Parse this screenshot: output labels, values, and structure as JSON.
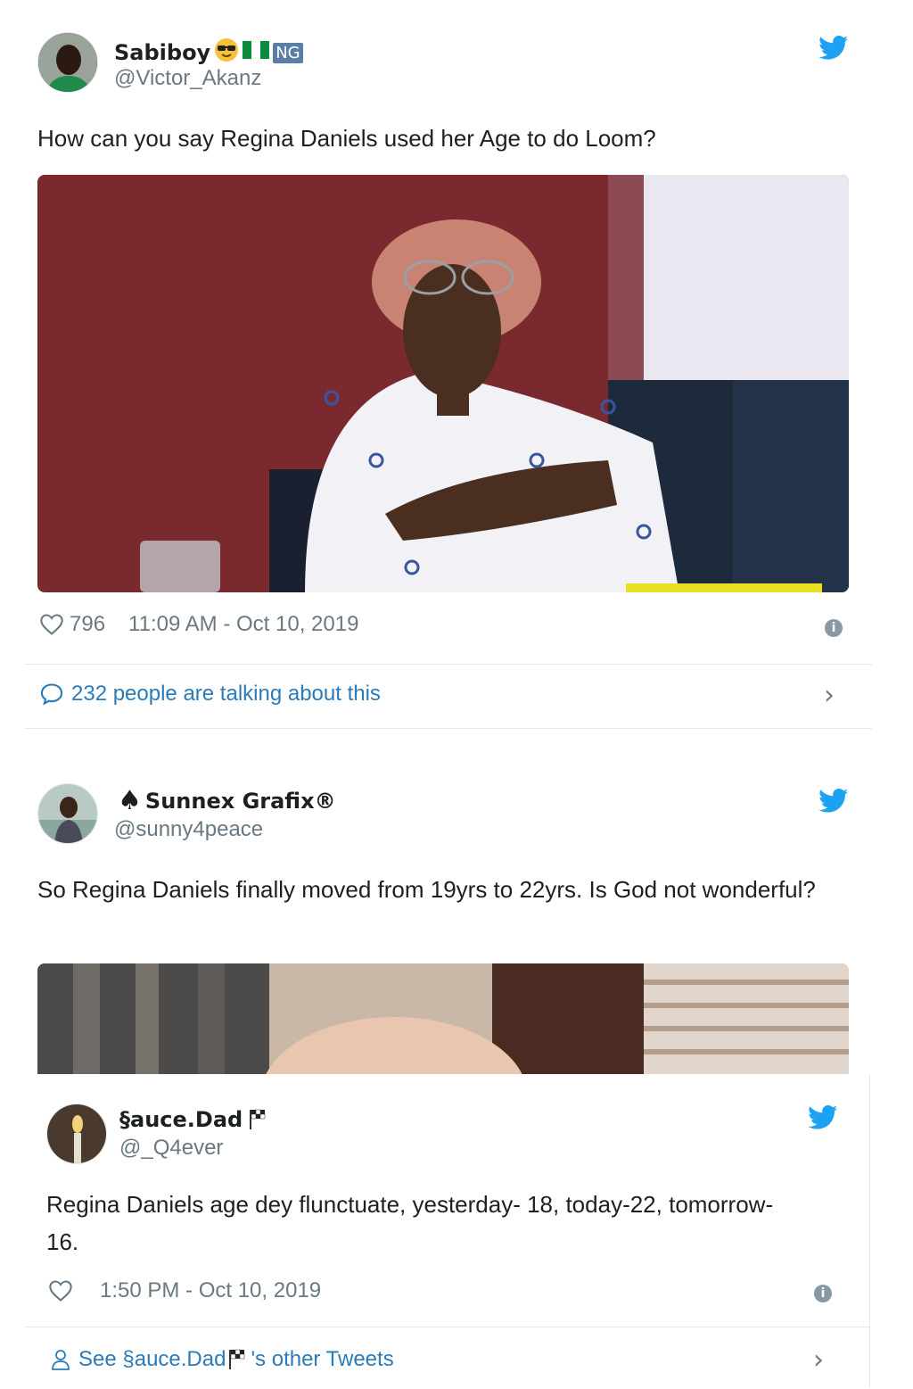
{
  "tweets": [
    {
      "name": "Sabiboy",
      "name_badge": "NG",
      "handle": "@Victor_Akanz",
      "text": "How can you say Regina Daniels used her Age to do Loom?",
      "likes": "796",
      "timestamp": "11:09 AM - Oct 10, 2019",
      "talking": "232 people are talking about this"
    },
    {
      "name": "Sunnex Grafix®",
      "handle": "@sunny4peace",
      "text": "So Regina Daniels finally moved from 19yrs to 22yrs. Is God not wonderful?"
    },
    {
      "name": "§auce.Dad",
      "handle": "@_Q4ever",
      "text": "Regina Daniels age dey flunctuate, yesterday- 18, today-22, tomorrow- 16.",
      "timestamp": "1:50 PM - Oct 10, 2019",
      "see_other_prefix": "See §auce.Dad",
      "see_other_suffix": "'s other Tweets"
    }
  ],
  "colors": {
    "twitter_blue": "#1da1f2",
    "link_blue": "#2b7bb9",
    "meta_gray": "#697882",
    "divider": "#e1e8ed"
  },
  "icons": [
    "twitter-bird-icon",
    "heart-icon",
    "info-icon",
    "reply-bubble-icon",
    "chevron-right-icon",
    "person-icon",
    "spade-icon",
    "checkered-flag-icon",
    "sunglasses-emoji-icon",
    "nigeria-flag-icon"
  ]
}
